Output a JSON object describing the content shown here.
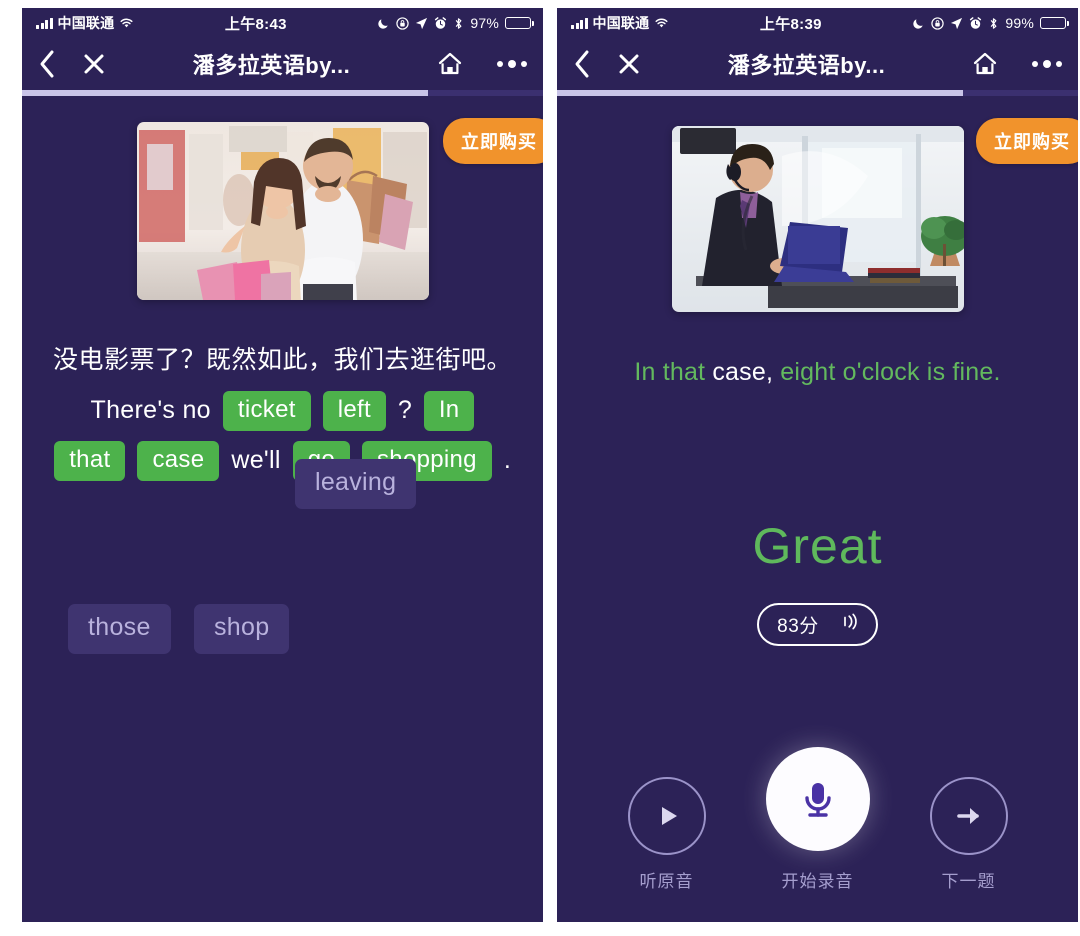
{
  "app": {
    "bg_color": "#2c2257",
    "accent_green": "#4db24b",
    "accent_orange": "#f1932c",
    "chip_bank_color": "#3f3470"
  },
  "left": {
    "status_bar": {
      "carrier": "中国联通",
      "time": "上午8:43",
      "battery_percent": "97%",
      "icons": [
        "signal-bars-icon",
        "wifi-icon",
        "moon-icon",
        "lock-rotation-icon",
        "location-arrow-icon",
        "alarm-clock-icon",
        "bluetooth-icon",
        "battery-icon"
      ]
    },
    "nav": {
      "back_label": "‹",
      "close_label": "✕",
      "title": "潘多拉英语by...",
      "home_label": "home-icon",
      "more_label": "•••"
    },
    "progress_percent": 78,
    "buy_button": "立即购买",
    "hero_image": "couple-shopping-mall-photo",
    "chinese_prompt": "没电影票了？既然如此，我们去逛街吧。",
    "sentence_tokens": [
      {
        "text": "There's no",
        "type": "plain"
      },
      {
        "text": "ticket",
        "type": "chip"
      },
      {
        "text": "left",
        "type": "chip"
      },
      {
        "text": "?",
        "type": "punct"
      },
      {
        "text": "In",
        "type": "chip"
      },
      {
        "text": "that",
        "type": "chip"
      },
      {
        "text": "case",
        "type": "chip"
      },
      {
        "text": "we'll",
        "type": "plain"
      },
      {
        "text": "go",
        "type": "chip"
      },
      {
        "text": "shopping",
        "type": "chip"
      },
      {
        "text": ".",
        "type": "punct"
      }
    ],
    "word_bank": [
      {
        "text": "leaving"
      },
      {
        "text": "those"
      },
      {
        "text": "shop"
      }
    ]
  },
  "right": {
    "status_bar": {
      "carrier": "中国联通",
      "time": "上午8:39",
      "battery_percent": "99%",
      "icons": [
        "signal-bars-icon",
        "wifi-icon",
        "moon-icon",
        "lock-rotation-icon",
        "location-arrow-icon",
        "alarm-clock-icon",
        "bluetooth-icon",
        "battery-icon"
      ]
    },
    "nav": {
      "back_label": "‹",
      "close_label": "✕",
      "title": "潘多拉英语by...",
      "home_label": "home-icon",
      "more_label": "•••"
    },
    "progress_percent": 78,
    "buy_button": "立即购买",
    "hero_image": "businessman-headset-laptop-photo",
    "result_tokens": [
      {
        "text": "In that ",
        "correct": true
      },
      {
        "text": "case,",
        "correct": false
      },
      {
        "text": " eight o'clock is fine.",
        "correct": true
      }
    ],
    "rating_text": "Great",
    "score_value": "83分",
    "score_icon": "sound-wave-icon",
    "controls": [
      {
        "label": "听原音",
        "icon": "play-icon",
        "primary": false
      },
      {
        "label": "开始录音",
        "icon": "microphone-icon",
        "primary": true
      },
      {
        "label": "下一题",
        "icon": "arrow-right-icon",
        "primary": false
      }
    ]
  }
}
